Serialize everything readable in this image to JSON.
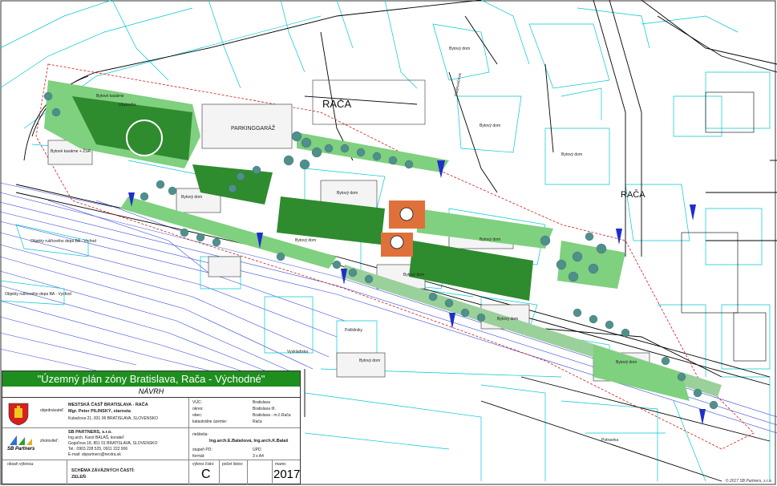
{
  "map": {
    "place_labels": [
      "RAČA",
      "RAČA"
    ],
    "street_label": "Sládkovičova",
    "parking_label": "PARKINGGARÁŽ",
    "building_labels": [
      "Bytový dom",
      "Bytový dom",
      "Bytový dom",
      "Bytový dom",
      "Bytový dom",
      "Bytový dom",
      "Bytový dom",
      "Bytový dom",
      "Bytový dom",
      "Bytový dom",
      "Bytové kasárne",
      "Ubytovňa",
      "Bytové kasárne + ŽSR",
      "Polikliniky",
      "Bytový dom",
      "Objekty rušňového depa BA - Vrchod",
      "Objekty rušňového depa BA - Vychod",
      "Vyskladiska",
      "Potravina"
    ],
    "colors": {
      "parcel_line": "#00c8d2",
      "road": "#000000",
      "rail": "#3a4bd8",
      "green_dark": "#2e8b2e",
      "green_light": "#7fd07f",
      "tree": "#4f8f8c",
      "plaza": "#e0703a"
    }
  },
  "title_block": {
    "title": "\"Územný plán zóny Bratislava, Rača - Východné\"",
    "subtitle": "NÁVRH",
    "objednavatel_label": "objednávateľ:",
    "objednavatel_name": "MESTSKÁ ČASŤ BRATISLAVA - RAČA",
    "objednavatel_person": "Mgr. Peter PILINSKÝ, starosta",
    "objednavatel_address": "Kubačova 21, 831 06 BRATISLAVA, SLOVENSKO",
    "zhotovitel_label": "zhotoviteľ:",
    "zhotovitel_name": "SB PARTNERS, s.r.o.",
    "zhotovitel_person": "Ing.arch. Karol BALAŠ, konateľ",
    "zhotovitel_address": "Gogoľova 18, 851 01 BRATISLAVA, SLOVENSKO",
    "zhotovitel_phone": "Tel.: 0903 228 525, 0911 222 906",
    "zhotovitel_email": "E-mail: sbpartners@nextra.sk",
    "logo_text": "SB Partners",
    "rows": [
      {
        "label": "VÚC:",
        "value": "Bratislava"
      },
      {
        "label": "okres:",
        "value": "Bratislava III."
      },
      {
        "label": "obec:",
        "value": "Bratislava - m.č.Rača"
      },
      {
        "label": "katastrálne územie:",
        "value": "Rača"
      }
    ],
    "riesitelia_label": "riešitelia:",
    "riesitelia_value": "Ing.arch.E.Balašová, Ing.arch.K.Balaš",
    "stupen_label": "stupeň PD:",
    "stupen_value": "ÚPD",
    "format_label": "formát:",
    "format_value": "3 x A4",
    "obsah_label": "obsah výkresu:",
    "obsah_line1": "SCHÉMA ZÁVÄZNÝCH ČASTÍ:",
    "obsah_line2": "ZELEŇ",
    "vykres_label": "výkres číslo:",
    "vykres_value": "C",
    "list_label": "list",
    "list_value": "",
    "pocet_label": "počet listov:",
    "pocet_value": "",
    "date_label": "marec",
    "date_value": "2017"
  },
  "copyright": "© 2017 SB Partners, s.r.o."
}
